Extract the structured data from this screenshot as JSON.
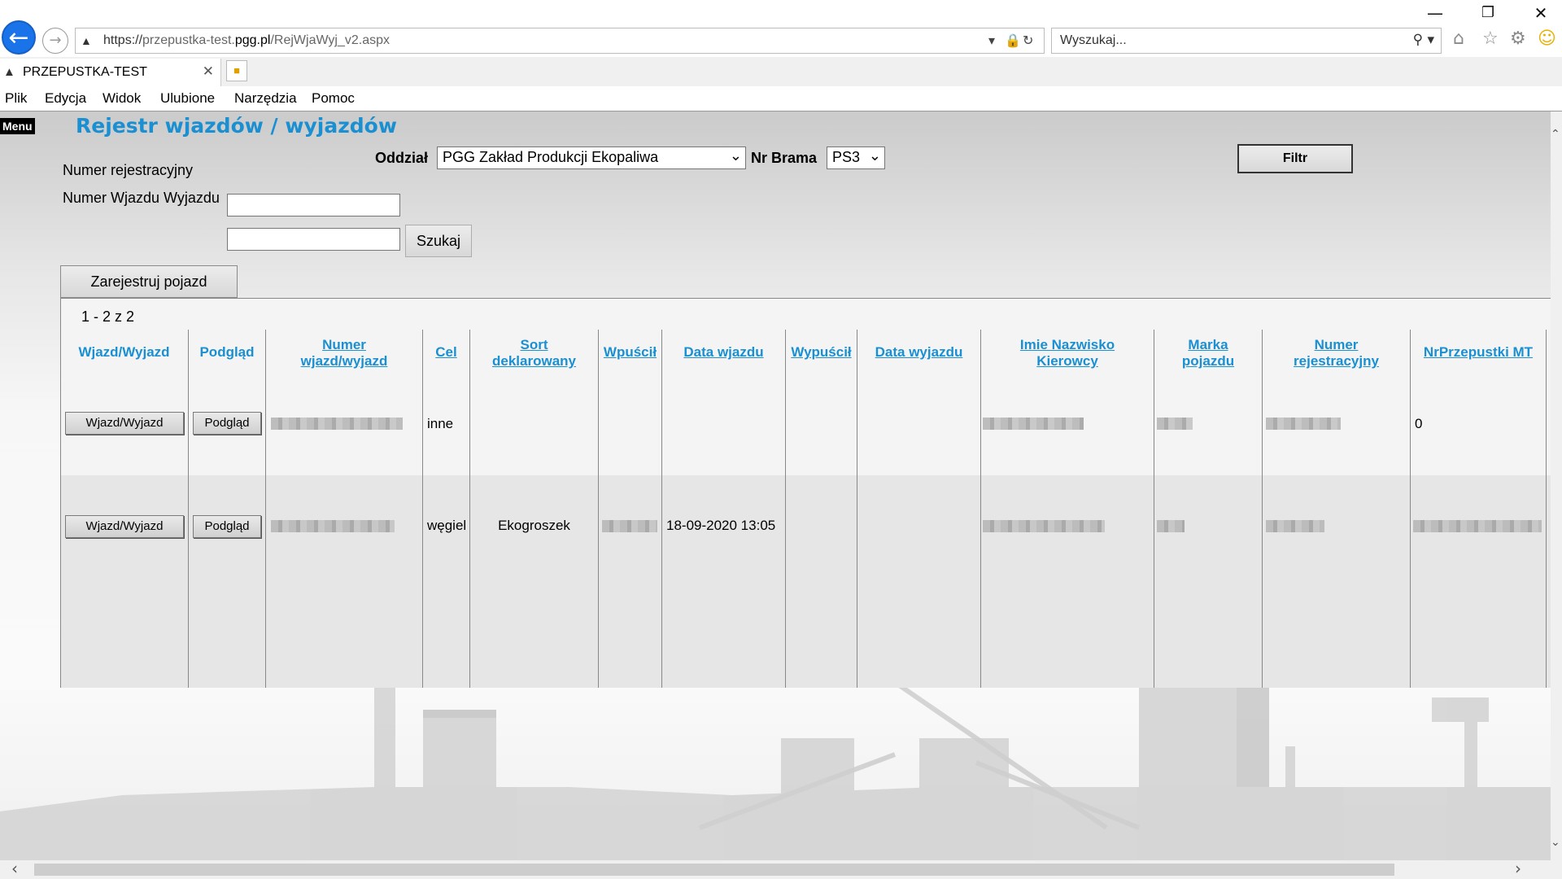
{
  "window": {
    "minimize": "—",
    "restore": "❐",
    "close": "✕"
  },
  "address": {
    "scheme": "https://",
    "subdomain": "przepustka-test.",
    "domain": "pgg.pl",
    "path": "/RejWjaWyj_v2.aspx"
  },
  "search": {
    "placeholder": "Wyszukaj..."
  },
  "tab": {
    "title": "PRZEPUSTKA-TEST"
  },
  "menubar": [
    "Plik",
    "Edycja",
    "Widok",
    "Ulubione",
    "Narzędzia",
    "Pomoc"
  ],
  "page": {
    "menu_label": "Menu",
    "title": "Rejestr wjazdów / wyjazdów",
    "oddzial_label": "Oddział",
    "oddzial_value": "PGG Zakład Produkcji Ekopaliwa",
    "brama_label": "Nr Brama",
    "brama_value": "PS3",
    "filtr_button": "Filtr",
    "reg_label": "Numer rejestracyjny",
    "wjazd_label": "Numer Wjazdu Wyjazdu",
    "search_button": "Szukaj",
    "register_button": "Zarejestruj pojazd",
    "pager": "1 - 2 z 2"
  },
  "table": {
    "headers": {
      "wjazd_wyjazd": "Wjazd/Wyjazd",
      "podglad": "Podgląd",
      "numer_l1": "Numer",
      "numer_l2": "wjazd/wyjazd",
      "cel": "Cel",
      "sort_l1": "Sort",
      "sort_l2": "deklarowany",
      "wpuscil": "Wpuścił",
      "data_wjazdu": "Data wjazdu",
      "wypuscil": "Wypuścił",
      "data_wyjazdu": "Data wyjazdu",
      "imie_l1": "Imie Nazwisko",
      "imie_l2": "Kierowcy",
      "marka_l1": "Marka",
      "marka_l2": "pojazdu",
      "nrrej_l1": "Numer",
      "nrrej_l2": "rejestracyjny",
      "nrprzep": "NrPrzepustki MT"
    },
    "rows": [
      {
        "btn_wjazd": "Wjazd/Wyjazd",
        "btn_podglad": "Podgląd",
        "cel": "inne",
        "sort": "",
        "data_wjazdu": "",
        "nrprzep": "0"
      },
      {
        "btn_wjazd": "Wjazd/Wyjazd",
        "btn_podglad": "Podgląd",
        "cel": "węgiel",
        "sort": "Ekogroszek",
        "data_wjazdu": "18-09-2020 13:05",
        "nrprzep": ""
      }
    ]
  },
  "colors": {
    "accent": "#1a8fd1",
    "back_button": "#1a73e8"
  }
}
